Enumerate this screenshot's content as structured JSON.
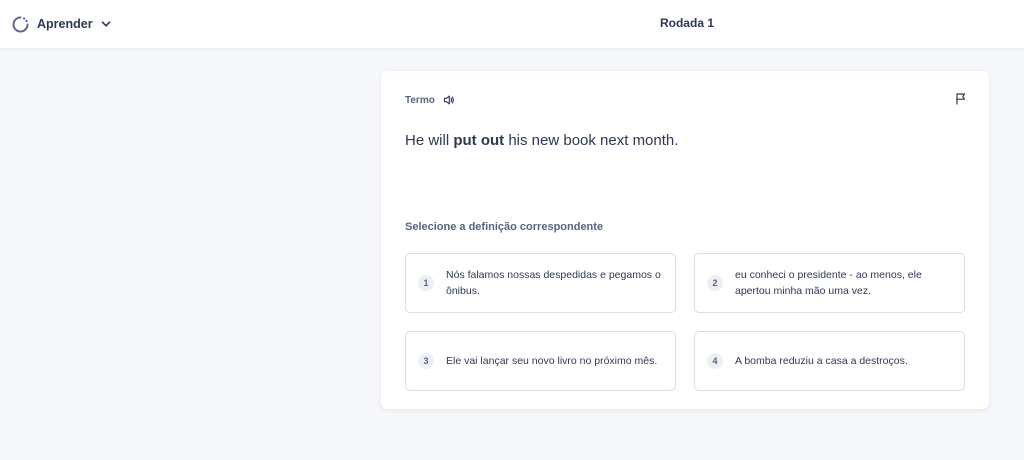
{
  "topbar": {
    "mode_label": "Aprender",
    "mode_icon": "learn-progress-icon",
    "dropdown_icon": "chevron-down-icon",
    "round_title": "Rodada 1"
  },
  "question": {
    "term_label": "Termo",
    "audio_icon": "speaker-icon",
    "flag_icon": "flag-icon",
    "sentence_before": "He will ",
    "sentence_bold": "put out",
    "sentence_after": " his new book next month.",
    "prompt": "Selecione a definição correspondente"
  },
  "options": [
    {
      "number": "1",
      "text": "Nós falamos nossas despedidas e pegamos o ônibus."
    },
    {
      "number": "2",
      "text": "eu conheci o presidente - ao menos, ele apertou minha mão uma vez."
    },
    {
      "number": "3",
      "text": "Ele vai lançar seu novo livro no próximo mês."
    },
    {
      "number": "4",
      "text": "A bomba reduziu a casa a destroços."
    }
  ],
  "colors": {
    "accent": "#4255ff",
    "text": "#2e3856",
    "muted": "#586380",
    "background": "#f6f7fb",
    "border": "#d9dde8"
  }
}
